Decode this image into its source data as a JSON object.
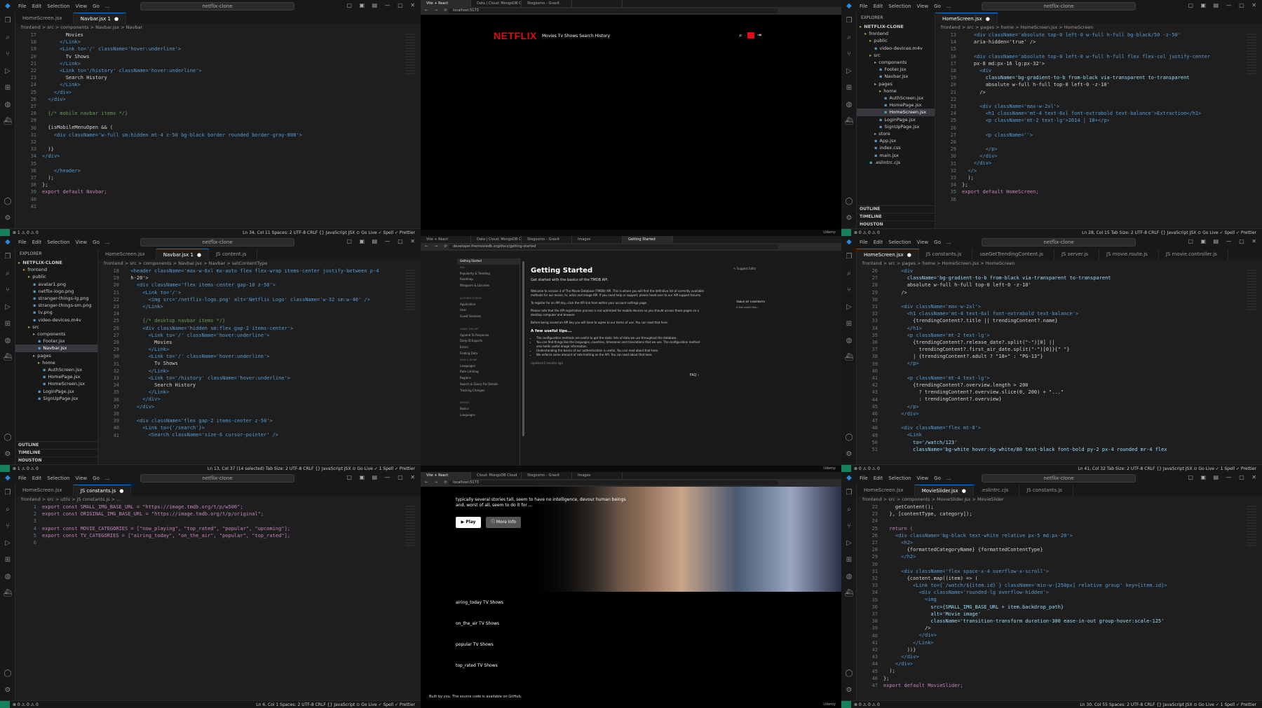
{
  "app": {
    "menu": [
      "File",
      "Edit",
      "Selection",
      "View",
      "Go",
      "..."
    ],
    "search": "netflix-clone",
    "footer_brand": "Udemy"
  },
  "panels": {
    "p1": {
      "tabs": [
        {
          "label": "HomeScreen.jsx",
          "active": false
        },
        {
          "label": "Navbar.jsx 1",
          "active": true
        }
      ],
      "crumbs": "frontend > src > components > Navbar.jsx > Navbar",
      "line_start": 17,
      "lines": [
        "        Movies",
        "      </Link>",
        "      <Link to='/' className='hover:underline'>",
        "        Tv Shows",
        "      </Link>",
        "      <Link to='/history' className='hover:underline'>",
        "        Search History",
        "      </Link>",
        "    </div>",
        "  </div>",
        "",
        "  {/* mobile navbar items */}",
        "",
        "  {isMobileMenuOpen && (",
        "    <div className='w-full sm:hidden mt-4 z-50 bg-black border rounded border-gray-800'>",
        "",
        "  )}",
        "</div>",
        "",
        "    </header>",
        "  );",
        "};",
        "export default Navbar;",
        "",
        ""
      ],
      "status_left": "⊗ 1 ⚠ 0  ⚠ 0",
      "status_right": "Ln 34, Col 11   Spaces: 2   UTF-8   CRLF   {} JavaScript JSX   ⊙ Go Live   ✓ Spell   ✓ Prettier"
    },
    "p2": {
      "browser_tabs": [
        "Vite + React",
        "Data | Cloud: MongoDB Cloud",
        "Stegosmo – Gravit",
        ""
      ],
      "url": "localhost:5173",
      "logo": "NETFLIX",
      "nav": "Movies  Tv Shows  Search History",
      "footer": "Udemy"
    },
    "p3": {
      "tabs": [
        {
          "label": "HomeScreen.jsx",
          "active": true
        }
      ],
      "crumbs": "frontend > src > pages > home > HomeScreen.jsx > HomeScreen",
      "explorer_title": "EXPLORER",
      "tree": [
        {
          "label": "NETFLIX-CLONE",
          "depth": 0,
          "bold": true
        },
        {
          "label": "frontend",
          "depth": 1
        },
        {
          "label": "public",
          "depth": 2
        },
        {
          "label": "video-devices.m4v",
          "depth": 3
        },
        {
          "label": "src",
          "depth": 2
        },
        {
          "label": "components",
          "depth": 3
        },
        {
          "label": "Footer.jsx",
          "depth": 4
        },
        {
          "label": "Navbar.jsx",
          "depth": 4
        },
        {
          "label": "pages",
          "depth": 3
        },
        {
          "label": "home",
          "depth": 4
        },
        {
          "label": "AuthScreen.jsx",
          "depth": 5
        },
        {
          "label": "HomePage.jsx",
          "depth": 5
        },
        {
          "label": "HomeScreen.jsx",
          "depth": 5,
          "active": true
        },
        {
          "label": "LoginPage.jsx",
          "depth": 4
        },
        {
          "label": "SignUpPage.jsx",
          "depth": 4
        },
        {
          "label": "store",
          "depth": 3
        },
        {
          "label": "App.jsx",
          "depth": 3
        },
        {
          "label": "index.css",
          "depth": 3
        },
        {
          "label": "main.jsx",
          "depth": 3
        },
        {
          "label": ".eslintrc.cjs",
          "depth": 2
        }
      ],
      "sections": [
        "OUTLINE",
        "TIMELINE",
        "HOUSTON"
      ],
      "line_start": 13,
      "lines": [
        "    <div className='absolute top-0 left-0 w-full h-full bg-black/50 -z-50'",
        "    aria-hidden='true' />",
        "",
        "    <div className='absolute top-0 left-0 w-full h-full flex flex-col justify-center",
        "    px-8 md:px-16 lg:px-32'>",
        "      <div",
        "        className='bg-gradient-to-b from-black via-transparent to-transparent",
        "        absolute w-full h-full top-0 left-0 -z-10'",
        "      />",
        "",
        "      <div className='max-w-2xl'>",
        "        <h1 className='mt-4 text-6xl font-extrabold text-balance'>Extraction</h1>",
        "        <p className='mt-2 text-lg'>2014 | 18+</p>",
        "",
        "        <p className=''>",
        "",
        "        </p>",
        "      </div>",
        "    </div>",
        "  </>",
        "  );",
        "};",
        "export default HomeScreen;",
        ""
      ],
      "status_left": "⊗ 0 ⚠ 0  ⚠ 0",
      "status_right": "Ln 28, Col 15   Tab Size: 2   UTF-8   CRLF   {} JavaScript JSX   ⊙ Go Live   ✓ Spell   ✓ Prettier"
    },
    "p4": {
      "tabs": [
        {
          "label": "HomeScreen.jsx",
          "active": false
        },
        {
          "label": "Navbar.jsx 1",
          "active": true
        },
        {
          "label": "JS content.js",
          "active": false
        }
      ],
      "crumbs": "frontend > src > components > Navbar.jsx > Navbar > setContentType",
      "explorer_title": "EXPLORER",
      "tree": [
        {
          "label": "NETFLIX-CLONE",
          "depth": 0,
          "bold": true
        },
        {
          "label": "frontend",
          "depth": 1
        },
        {
          "label": "public",
          "depth": 2
        },
        {
          "label": "avatar1.png",
          "depth": 3
        },
        {
          "label": "netflix-logo.png",
          "depth": 3
        },
        {
          "label": "stranger-things-lg.png",
          "depth": 3
        },
        {
          "label": "stranger-things-sm.png",
          "depth": 3
        },
        {
          "label": "tv.png",
          "depth": 3
        },
        {
          "label": "video-devices.m4v",
          "depth": 3
        },
        {
          "label": "src",
          "depth": 2
        },
        {
          "label": "components",
          "depth": 3
        },
        {
          "label": "Footer.jsx",
          "depth": 4
        },
        {
          "label": "Navbar.jsx",
          "depth": 4,
          "active": true
        },
        {
          "label": "pages",
          "depth": 3
        },
        {
          "label": "home",
          "depth": 4
        },
        {
          "label": "AuthScreen.jsx",
          "depth": 5
        },
        {
          "label": "HomePage.jsx",
          "depth": 5
        },
        {
          "label": "HomeScreen.jsx",
          "depth": 5
        },
        {
          "label": "LoginPage.jsx",
          "depth": 4
        },
        {
          "label": "SignUpPage.jsx",
          "depth": 4
        }
      ],
      "sections": [
        "OUTLINE",
        "TIMELINE",
        "HOUSTON"
      ],
      "line_start": 18,
      "lines": [
        "  <header className='max-w-6xl mx-auto flex flex-wrap items-center justify-between p-4",
        "  h-20'>",
        "    <div className='flex items-center gap-10 z-50'>",
        "      <Link to='/'>",
        "        <img src='/netflix-logo.png' alt='Netflix Logo' className='w-32 sm:w-40' />",
        "      </Link>",
        "",
        "      {/* desktop navbar items */}",
        "      <div className='hidden sm:flex gap-2 items-center'>",
        "        <Link to='/' className='hover:underline'>",
        "          Movies",
        "        </Link>",
        "        <Link to='/' className='hover:underline'>",
        "          Tv Shows",
        "        </Link>",
        "        <Link to='/history' className='hover:underline'>",
        "          Search History",
        "        </Link>",
        "      </div>",
        "    </div>",
        "",
        "    <div className='flex gap-2 items-center z-50'>",
        "      <Link to={'/search'}>",
        "        <Search className='size-6 cursor-pointer' />"
      ],
      "status_left": "⊗ 1 ⚠ 0  ⚠ 0",
      "status_right": "Ln 13, Col 37 (14 selected)   Tab Size: 2   UTF-8   CRLF   {} JavaScript JSX   ⊙ Go Live   ✓ 1 Spell   ✓ Prettier"
    },
    "p5": {
      "browser_tabs": [
        "Vite + React",
        "Data | Cloud: MongoDB Cloud",
        "Stegosmo – Gravit",
        "Images",
        "Getting Started"
      ],
      "url": "developer.themoviedb.org/docs/getting-started",
      "sidebar": [
        "Getting Started",
        "FAQ",
        "Popularity & Trending",
        "Roadmap",
        "Wrappers & Libraries",
        "",
        "AUTHENTICATION",
        "Application",
        "User",
        "Guest Sessions",
        "",
        "USING THE API",
        "Append To Response",
        "Daily ID Exports",
        "Errors",
        "Finding Data",
        "JSON & JSONP",
        "Languages",
        "Rate Limiting",
        "Regions",
        "Search & Query For Details",
        "Tracking Changes",
        "",
        "IMAGES",
        "Basics",
        "Languages"
      ],
      "title": "Getting Started",
      "subtitle": "Get started with the basics of the TMDB API.",
      "paragraphs": [
        "Welcome to version 3 of The Movie Database (TMDB) API. This is where you will find the definitive list of currently available methods for our movie, tv, actor and image API. If you need help or support, please head over to our API support forums.",
        "To register for an API key, click the API link from within your account settings page.",
        "Please note that the API registration process is not optimized for mobile devices so you should access these pages on a desktop computer and browser.",
        "Before being issued an API key you will have to agree to our terms of use. You can read that here."
      ],
      "tips_title": "A few useful tips...",
      "tips": [
        "The configuration methods are useful to get the static lists of data we use throughout the database.",
        "You can find things like the languages, countries, timezones and translations that we use. The configuration method also holds useful image information.",
        "Understanding the basics of our authentication is useful. You can read about that here.",
        "We enforce some amount of rate limiting on the API. You can read about that here."
      ],
      "updated": "Updated 6 months ago",
      "suggest": "Suggest Edits",
      "toc_title": "TABLE OF CONTENTS",
      "toc_item": "A few useful tips...",
      "next": "FAQ"
    },
    "p6": {
      "tabs": [
        {
          "label": "HomeScreen.jsx",
          "active": true
        },
        {
          "label": "JS constants.js",
          "active": false
        },
        {
          "label": "useGetTrendingContent.js",
          "active": false
        },
        {
          "label": "JS server.js",
          "active": false
        },
        {
          "label": "JS movie.route.js",
          "active": false
        },
        {
          "label": "JS movie.controller.js",
          "active": false
        }
      ],
      "crumbs": "frontend > src > pages > home > HomeScreen.jsx > HomeScreen",
      "line_start": 26,
      "lines": [
        "      <div",
        "        className='bg-gradient-to-b from-black via-transparent to-transparent",
        "        absolute w-full h-full top-0 left-0 -z-10'",
        "      />",
        "",
        "      <div className='max-w-2xl'>",
        "        <h1 className='mt-4 text-6xl font-extrabold text-balance'>",
        "          {trendingContent?.title || trendingContent?.name}",
        "        </h1>",
        "        <p className='mt-2 text-lg'>",
        "          {trendingContent?.release_date?.split(\"-\")[0] ||",
        "            trendingContent?.first_air_date.split(\"-\")[0]}{\" \"}",
        "          | {trendingContent?.adult ? \"18+\" : \"PG-13\"}",
        "        </p>",
        "",
        "        <p className='mt-4 text-lg'>",
        "          {trendingContent?.overview.length > 200",
        "            ? trendingContent?.overview.slice(0, 200) + \"...\"",
        "            : trendingContent?.overview}",
        "        </p>",
        "      </div>",
        "",
        "      <div className='flex mt-8'>",
        "        <Link",
        "          to='/watch/123'",
        "          className='bg-white hover:bg-white/80 text-black font-bold py-2 px-4 rounded mr-4 flex"
      ],
      "status_left": "⊗ 0 ⚠ 0  ⚠ 0",
      "status_right": "Ln 41, Col 32   Tab Size: 2   UTF-8   CRLF   {} JavaScript JSX   ⊙ Go Live   ✓ 1 Spell   ✓ Prettier"
    },
    "p7": {
      "tabs": [
        {
          "label": "HomeScreen.jsx",
          "active": false
        },
        {
          "label": "JS constants.js",
          "active": true
        }
      ],
      "crumbs": "frontend > src > utils > JS constants.js > ...",
      "line_start": 1,
      "lines": [
        "export const SMALL_IMG_BASE_URL = \"https://image.tmdb.org/t/p/w500\";",
        "export const ORIGINAL_IMG_BASE_URL = \"https://image.tmdb.org/t/p/original\";",
        "",
        "export const MOVIE_CATEGORIES = [\"now_playing\", \"top_rated\", \"popular\", \"upcoming\"];",
        "export const TV_CATEGORIES = [\"airing_today\", \"on_the_air\", \"popular\", \"top_rated\"];",
        ""
      ],
      "status_left": "⊗ 0 ⚠ 0  ⚠ 0",
      "status_right": "Ln 6, Col 1   Spaces: 2   UTF-8   CRLF   {} JavaScript   ⊙ Go Live   ✓ Spell   ✓ Prettier"
    },
    "p8": {
      "browser_tabs": [
        "Vite + React",
        "Cloud: MongoDB Cloud",
        "Stegosmo – Gravit",
        "Images"
      ],
      "url": "localhost:5173",
      "hero_text": "typically several stories tall, seem to have no intelligence, devour human beings and, worst of all, seem to do it for ...",
      "play": "Play",
      "more_info": "More Info",
      "rows": [
        "airing_today TV Shows",
        "on_the_air TV Shows",
        "popular TV Shows",
        "top_rated TV Shows"
      ],
      "footer_by": "Built by you. The source code is available on GitHub."
    },
    "p9": {
      "tabs": [
        {
          "label": "HomeScreen.jsx",
          "active": false
        },
        {
          "label": "MovieSlider.jsx",
          "active": true
        },
        {
          "label": ".eslintrc.cjs",
          "active": false
        },
        {
          "label": "JS constants.js",
          "active": false
        }
      ],
      "crumbs": "frontend > src > components > MovieSlider.jsx > MovieSlider",
      "line_start": 22,
      "lines": [
        "    getContent();",
        "  }, [contentType, category]);",
        "",
        "  return (",
        "    <div className='bg-black text-white relative px-5 md:px-20'>",
        "      <h2>",
        "        {formattedCategoryName} {formattedContentType}",
        "      </h2>",
        "",
        "      <div className='flex space-x-4 overflow-x-scroll'>",
        "        {content.map((item) => (",
        "          <Link to={`/watch/${item.id}`} className='min-w-[250px] relative group' key={item.id}>",
        "            <div className='rounded-lg overflow-hidden'>",
        "              <img",
        "                src={SMALL_IMG_BASE_URL + item.backdrop_path}",
        "                alt='Movie image'",
        "                className='transition-transform duration-300 ease-in-out group-hover:scale-125'",
        "              />",
        "            </div>",
        "          </Link>",
        "        ))}",
        "      </div>",
        "    </div>",
        "  );",
        "};",
        "export default MovieSlider;"
      ],
      "status_left": "⊗ 0 ⚠ 0  ⚠ 0",
      "status_right": "Ln 30, Col 55   Spaces: 2   UTF-8   CRLF   {} JavaScript JSX   ⊙ Go Live   ✓ 1 Spell   ✓ Prettier"
    }
  },
  "colors": {
    "netflix_red": "#e50914",
    "vscode_bg": "#1e1e1e",
    "accent": "#0078d4"
  }
}
